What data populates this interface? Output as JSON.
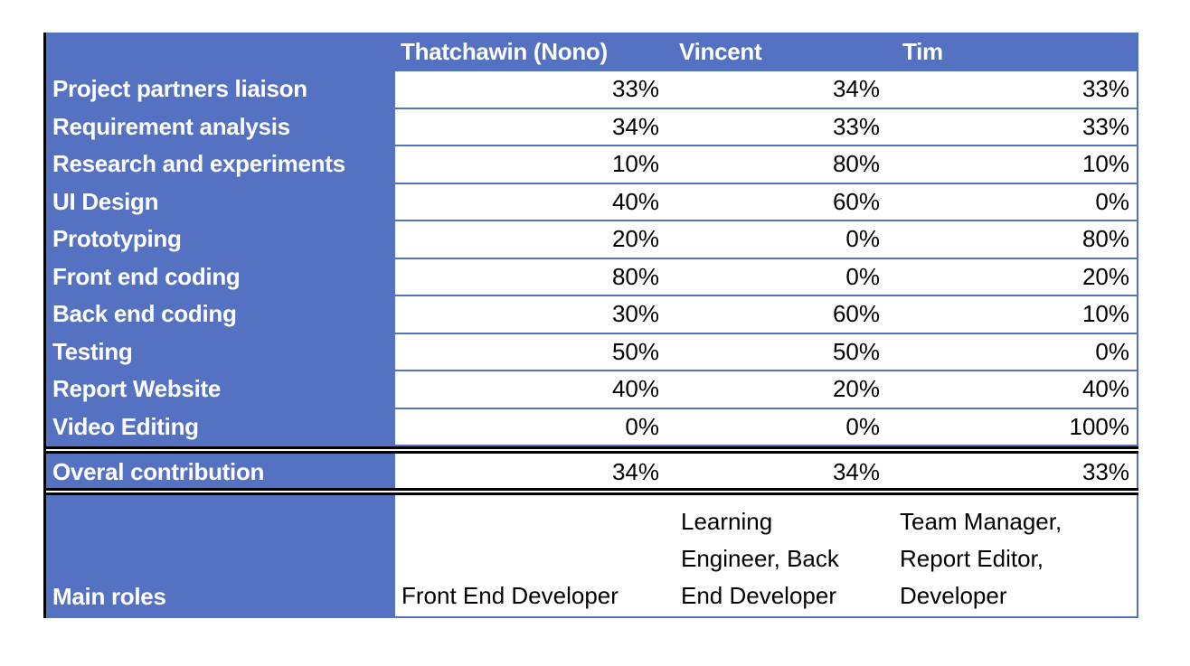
{
  "table": {
    "headers": [
      "Thatchawin (Nono)",
      "Vincent",
      "Tim"
    ],
    "rows": [
      {
        "task": "Project partners liaison",
        "values": [
          "33%",
          "34%",
          "33%"
        ]
      },
      {
        "task": "Requirement analysis",
        "values": [
          "34%",
          "33%",
          "33%"
        ]
      },
      {
        "task": "Research and experiments",
        "values": [
          "10%",
          "80%",
          "10%"
        ]
      },
      {
        "task": "UI Design",
        "values": [
          "40%",
          "60%",
          "0%"
        ]
      },
      {
        "task": "Prototyping",
        "values": [
          "20%",
          "0%",
          "80%"
        ]
      },
      {
        "task": "Front end coding",
        "values": [
          "80%",
          "0%",
          "20%"
        ]
      },
      {
        "task": "Back end coding",
        "values": [
          "30%",
          "60%",
          "10%"
        ]
      },
      {
        "task": "Testing",
        "values": [
          "50%",
          "50%",
          "0%"
        ]
      },
      {
        "task": "Report Website",
        "values": [
          "40%",
          "20%",
          "40%"
        ]
      },
      {
        "task": "Video Editing",
        "values": [
          "0%",
          "0%",
          "100%"
        ]
      }
    ],
    "overall": {
      "label": "Overal contribution",
      "values": [
        "34%",
        "34%",
        "33%"
      ]
    },
    "roles": {
      "label": "Main roles",
      "values": [
        "Front End Developer",
        "Machine Learning Engineer, Back End Developer",
        "Team Manager, Report Editor, Developer"
      ],
      "visible_lines": [
        [
          "Front End Developer"
        ],
        [
          "Learning",
          "Engineer, Back",
          "End Developer"
        ],
        [
          "Team Manager,",
          "Report Editor,",
          "Developer"
        ]
      ]
    }
  },
  "colors": {
    "header_blue": "#5572C2",
    "text_dark": "#000000",
    "text_light": "#FFFFFF"
  }
}
